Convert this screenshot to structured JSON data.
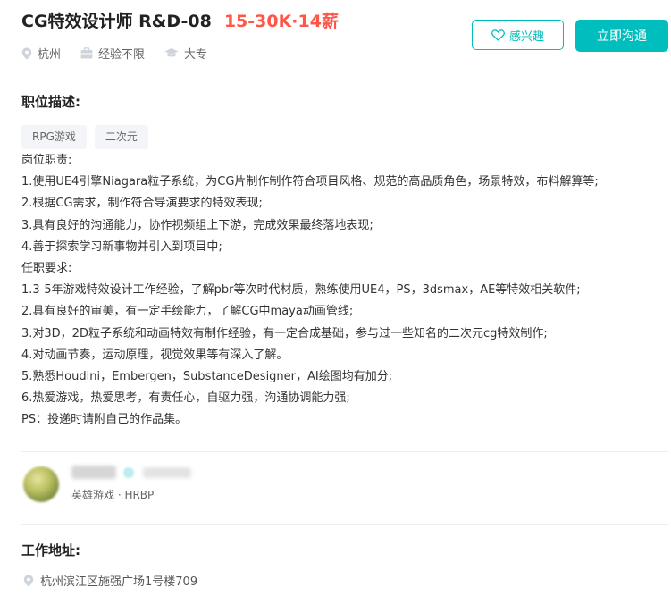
{
  "job": {
    "title": "CG特效设计师 R&D-08",
    "salary": "15-30K·14薪",
    "location": "杭州",
    "experience": "经验不限",
    "education": "大专"
  },
  "actions": {
    "interest_label": "感兴趣",
    "chat_label": "立即沟通"
  },
  "description": {
    "heading": "职位描述:",
    "tags": [
      "RPG游戏",
      "二次元"
    ],
    "lines": [
      "岗位职责:",
      "1.使用UE4引擎Niagara粒子系统，为CG片制作制作符合项目风格、规范的高品质角色，场景特效，布料解算等;",
      "2.根据CG需求，制作符合导演要求的特效表现;",
      "3.具有良好的沟通能力，协作视频组上下游，完成效果最终落地表现;",
      "4.善于探索学习新事物并引入到项目中;",
      "任职要求:",
      "1.3-5年游戏特效设计工作经验，了解pbr等次时代材质，熟练使用UE4，PS，3dsmax，AE等特效相关软件;",
      "2.具有良好的审美，有一定手绘能力，了解CG中maya动画管线;",
      "3.对3D，2D粒子系统和动画特效有制作经验，有一定合成基础，参与过一些知名的二次元cg特效制作;",
      "4.对动画节奏，运动原理，视觉效果等有深入了解。",
      "5.熟悉Houdini，Embergen，SubstanceDesigner，AI绘图均有加分;",
      "6.热爱游戏，热爱思考，有责任心，自驱力强，沟通协调能力强;",
      "PS：投递时请附自己的作品集。"
    ]
  },
  "recruiter": {
    "company_role": "英雄游戏 · HRBP"
  },
  "workplace": {
    "heading": "工作地址:",
    "address": "杭州滨江区施强广场1号楼709"
  },
  "colors": {
    "accent": "#00bebd",
    "salary": "#fe574a"
  }
}
